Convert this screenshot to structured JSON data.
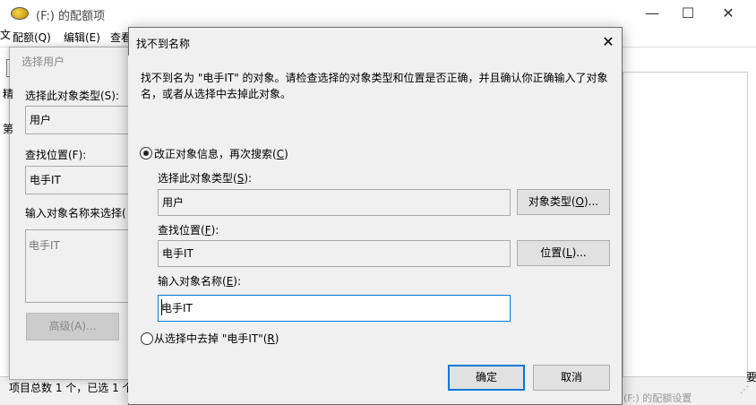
{
  "background_window": {
    "title": "(F:) 的配额项",
    "menu": [
      "配额(Q)",
      "编辑(E)",
      "查看"
    ],
    "menu_partial_left": "文",
    "status": "项目总数 1 个，已选 1 个",
    "bottom_right_text": "(F:) 的配额设置",
    "right_edge_glyph": "要",
    "window_controls": {
      "minimize": "—",
      "maximize": "☐",
      "close": "✕"
    }
  },
  "select_dialog": {
    "title": "选择用户",
    "object_type_label": "选择此对象类型(S):",
    "object_type_value": "用户",
    "location_label": "查找位置(F):",
    "location_value": "电手IT",
    "names_label": "输入对象名称来选择(",
    "names_value": "电手IT",
    "advanced_button": "高级(A)...",
    "left_glyphs": [
      "文",
      "精",
      "第"
    ]
  },
  "error_dialog": {
    "title": "找不到名称",
    "close_glyph": "✕",
    "message": "找不到名为 \"电手IT\" 的对象。请检查选择的对象类型和位置是否正确，并且确认你正确输入了对象名，或者从选择中去掉此对象。",
    "option_correct": {
      "text": "改正对象信息，再次搜索(",
      "key": "C",
      "suffix": ")",
      "selected": true
    },
    "object_type_label": {
      "text": "选择此对象类型(",
      "key": "S",
      "suffix": "):"
    },
    "object_type_value": "用户",
    "object_type_button": {
      "text": "对象类型(",
      "key": "O",
      "suffix": ")..."
    },
    "location_label": {
      "text": "查找位置(",
      "key": "F",
      "suffix": "):"
    },
    "location_value": "电手IT",
    "location_button": {
      "text": "位置(",
      "key": "L",
      "suffix": ")..."
    },
    "name_label": {
      "text": "输入对象名称(",
      "key": "E",
      "suffix": "):"
    },
    "name_value": "电手IT",
    "option_remove": {
      "text": "从选择中去掉 \"电手IT\"(",
      "key": "R",
      "suffix": ")",
      "selected": false
    },
    "ok_button": "确定",
    "cancel_button": "取消"
  },
  "colors": {
    "accent": "#0078d7",
    "dialog_bg": "#f0f0f0",
    "button_bg": "#e1e1e1"
  }
}
